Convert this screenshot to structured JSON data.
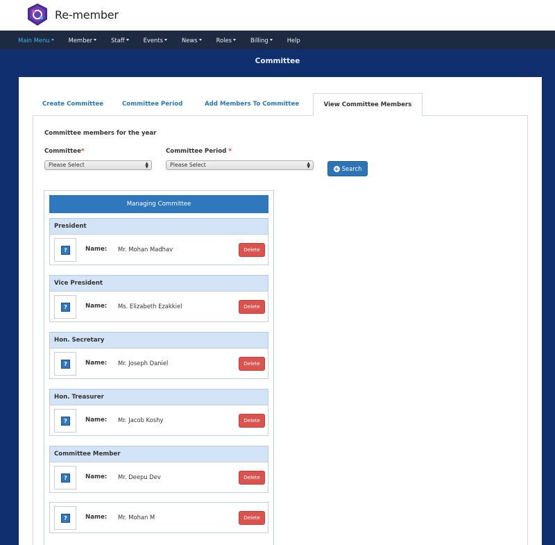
{
  "app": {
    "brand": "Re-member"
  },
  "nav": {
    "items": [
      {
        "label": "Main Menu",
        "active": true
      },
      {
        "label": "Member",
        "active": false
      },
      {
        "label": "Staff",
        "active": false
      },
      {
        "label": "Events",
        "active": false
      },
      {
        "label": "News",
        "active": false
      },
      {
        "label": "Roles",
        "active": false
      },
      {
        "label": "Billing",
        "active": false
      },
      {
        "label": "Help",
        "active": false,
        "no_caret": true
      }
    ]
  },
  "page": {
    "title": "Committee"
  },
  "tabs": [
    {
      "label": "Create Committee"
    },
    {
      "label": "Committee Period"
    },
    {
      "label": "Add Members To Committee"
    },
    {
      "label": "View Committee Members",
      "active": true
    }
  ],
  "form": {
    "heading": "Committee members for the year",
    "committee_label": "Committee",
    "committee_value": "Please Select",
    "period_label": "Committee Period",
    "period_value": "Please Select",
    "required_mark": "*",
    "search_label": "Search"
  },
  "committee": {
    "title": "Managing Committee",
    "name_label": "Name:",
    "delete_label": "Delete",
    "roles": [
      {
        "role": "President",
        "name": "Mr. Mohan Madhav"
      },
      {
        "role": "Vice President",
        "name": "Ms. Elizabeth Ezakkiel"
      },
      {
        "role": "Hon. Secretary",
        "name": "Mr. Joseph Daniel"
      },
      {
        "role": "Hon. Treasurer",
        "name": "Mr. Jacob Koshy"
      },
      {
        "role": "Committee Member",
        "name": "Mr. Deepu Dev"
      }
    ],
    "extra_member": {
      "name": "Mr. Mohan M"
    }
  },
  "colors": {
    "nav_bg": "#1d2a42",
    "page_bg": "#0f2f6e",
    "accent": "#2f78be",
    "delete": "#d9534f",
    "active_nav": "#3fb2f0"
  }
}
